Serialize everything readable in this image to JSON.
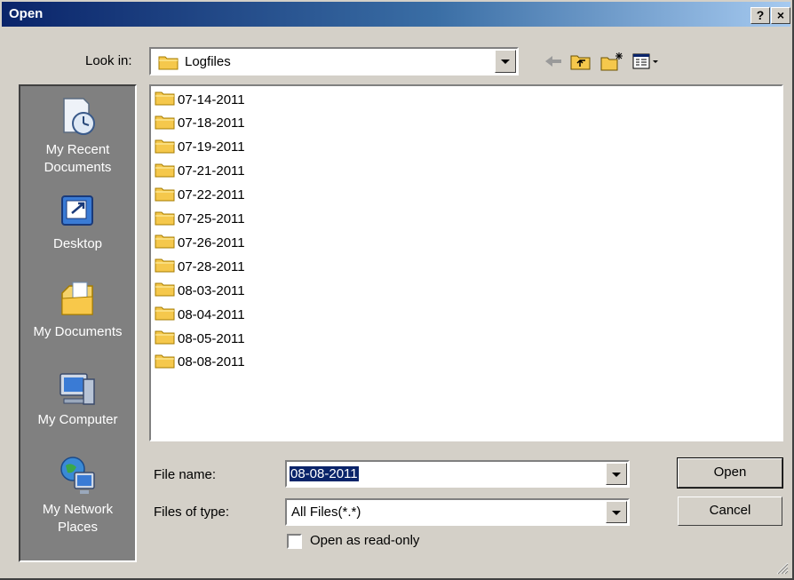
{
  "window": {
    "title": "Open",
    "help_button": "?",
    "close_button": "×"
  },
  "lookin": {
    "label": "Look in:",
    "value": "Logfiles",
    "icon": "folder-icon"
  },
  "toolbar": {
    "icons": [
      "back-arrow-icon",
      "up-one-level-icon",
      "new-folder-icon",
      "view-menu-icon"
    ]
  },
  "places": [
    {
      "label": "My Recent\nDocuments",
      "icon": "recent-documents-icon"
    },
    {
      "label": "Desktop",
      "icon": "desktop-icon"
    },
    {
      "label": "My Documents",
      "icon": "my-documents-icon"
    },
    {
      "label": "My Computer",
      "icon": "my-computer-icon"
    },
    {
      "label": "My Network\nPlaces",
      "icon": "network-places-icon"
    }
  ],
  "files": [
    "07-14-2011",
    "07-18-2011",
    "07-19-2011",
    "07-21-2011",
    "07-22-2011",
    "07-25-2011",
    "07-26-2011",
    "07-28-2011",
    "08-03-2011",
    "08-04-2011",
    "08-05-2011",
    "08-08-2011"
  ],
  "filename": {
    "label": "File name:",
    "value": "08-08-2011"
  },
  "filetype": {
    "label": "Files of type:",
    "value": "All Files(*.*)"
  },
  "buttons": {
    "open": "Open",
    "cancel": "Cancel"
  },
  "readonly": {
    "label": "Open as read-only",
    "checked": false
  },
  "colors": {
    "title_start": "#0a246a",
    "title_end": "#a6caf0",
    "dialog_bg": "#d4d0c8",
    "places_bg": "#808080",
    "selection": "#0a246a",
    "folder": "#f5c84c"
  }
}
